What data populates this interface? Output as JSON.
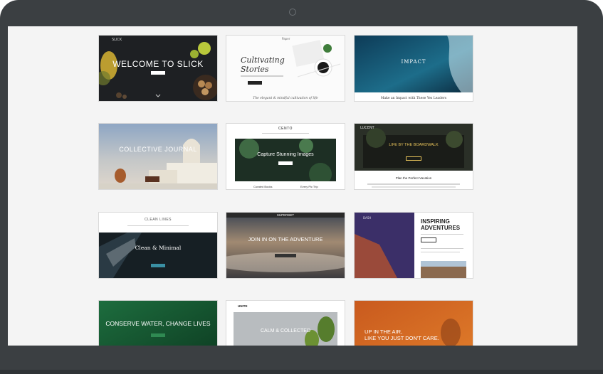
{
  "templates": [
    {
      "id": "slick",
      "headline": "WELCOME TO SLICK",
      "logo": "SLICK"
    },
    {
      "id": "paper",
      "headline_1": "Cultivating",
      "headline_2": "Stories",
      "logo": "Paper",
      "footer": "The elegant & mindful cultivation of life"
    },
    {
      "id": "impact",
      "headline": "IMPACT",
      "footer": "Make an Impact with These Yes Leaders"
    },
    {
      "id": "journal",
      "headline": "COLLECTIVE JOURNAL"
    },
    {
      "id": "cento",
      "logo": "CENTO",
      "headline": "Capture Stunning Images",
      "footer_left": "Curated Books",
      "footer_right": "Every Pic Trip"
    },
    {
      "id": "lucent",
      "logo": "LUCENT",
      "headline": "LIFE BY THE BOARDWALK",
      "subhead": "Plan the Perfect Vacation"
    },
    {
      "id": "clean",
      "logo": "CLEAN LINES",
      "headline": "Clean & Minimal"
    },
    {
      "id": "superset",
      "logo": "SUPERSET",
      "headline": "JOIN IN ON THE ADVENTURE"
    },
    {
      "id": "dash",
      "logo": "DASH",
      "headline_1": "INSPIRING",
      "headline_2": "ADVENTURES"
    },
    {
      "id": "conserve",
      "headline": "CONSERVE WATER, CHANGE LIVES"
    },
    {
      "id": "unite",
      "logo": "UNITE",
      "headline": "CALM & COLLECTED"
    },
    {
      "id": "air",
      "headline_1": "UP IN THE AIR,",
      "headline_2": "LIKE YOU JUST DON'T CARE."
    }
  ]
}
